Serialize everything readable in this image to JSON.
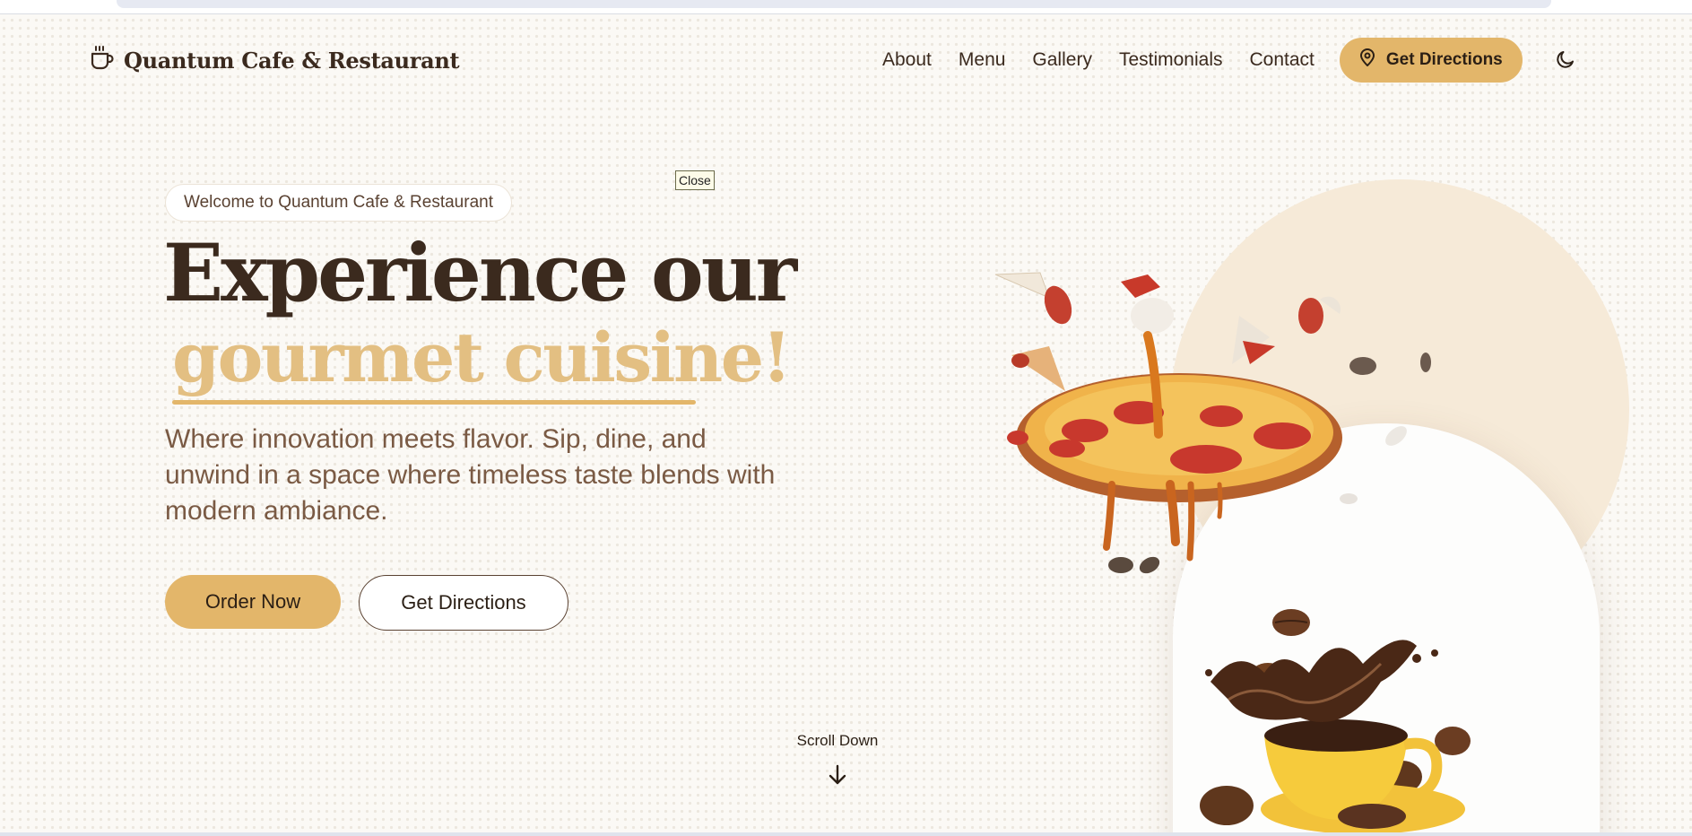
{
  "brand": {
    "name": "Quantum Cafe & Restaurant",
    "icon": "coffee-cup-icon"
  },
  "nav": {
    "items": [
      {
        "label": "About"
      },
      {
        "label": "Menu"
      },
      {
        "label": "Gallery"
      },
      {
        "label": "Testimonials"
      },
      {
        "label": "Contact"
      }
    ],
    "cta_label": "Get Directions",
    "cta_icon": "map-pin-icon",
    "theme_icon": "moon-icon"
  },
  "hero": {
    "welcome_badge": "Welcome to Quantum Cafe & Restaurant",
    "close_label": "Close",
    "headline_line1": "Experience our",
    "headline_line2": "gourmet cuisine!",
    "subtitle": "Where innovation meets flavor. Sip, dine, and unwind in a space where timeless taste blends with modern ambiance.",
    "primary_button": "Order Now",
    "secondary_button": "Get Directions",
    "scroll_label": "Scroll Down",
    "scroll_icon": "arrow-down-icon",
    "images": [
      "pizza-image",
      "coffee-splash-image"
    ]
  },
  "colors": {
    "accent": "#e3b66a",
    "accent_light": "#e3bf82",
    "text_dark": "#3b2a1e",
    "text_muted": "#7a5a44",
    "background": "#fbf9f5"
  }
}
